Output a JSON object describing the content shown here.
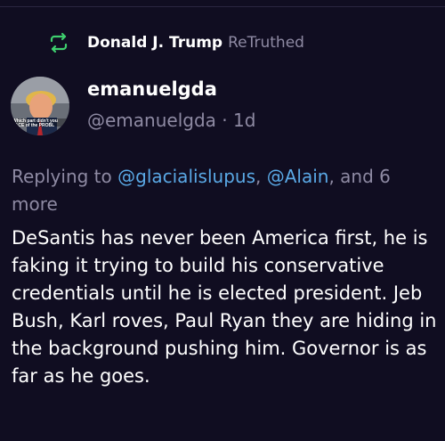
{
  "retruth": {
    "user_name": "Donald J. Trump",
    "action": "ReTruthed",
    "icon": "retruth-icon",
    "icon_color": "#3ecf6e"
  },
  "author": {
    "display_name": "emanuelgda",
    "handle": "@emanuelgda",
    "separator": " · ",
    "time_ago": "1d",
    "avatar_caption": "Which part didn't you ... FACE of the PROBL..."
  },
  "reply": {
    "prefix": "Replying to ",
    "mention_1": "@glacialislupus",
    "comma": ", ",
    "mention_2": "@Alain",
    "suffix": ", and 6 more"
  },
  "post": {
    "text": "DeSantis has never been America first, he is faking it trying to build his conservative credentials until he is elected president.  Jeb Bush, Karl roves, Paul Ryan they are hiding in the background pushing him. Governor is as far as he goes."
  },
  "colors": {
    "background": "#100d21",
    "muted_text": "#8e8aa3",
    "mention": "#5aa9e6"
  }
}
